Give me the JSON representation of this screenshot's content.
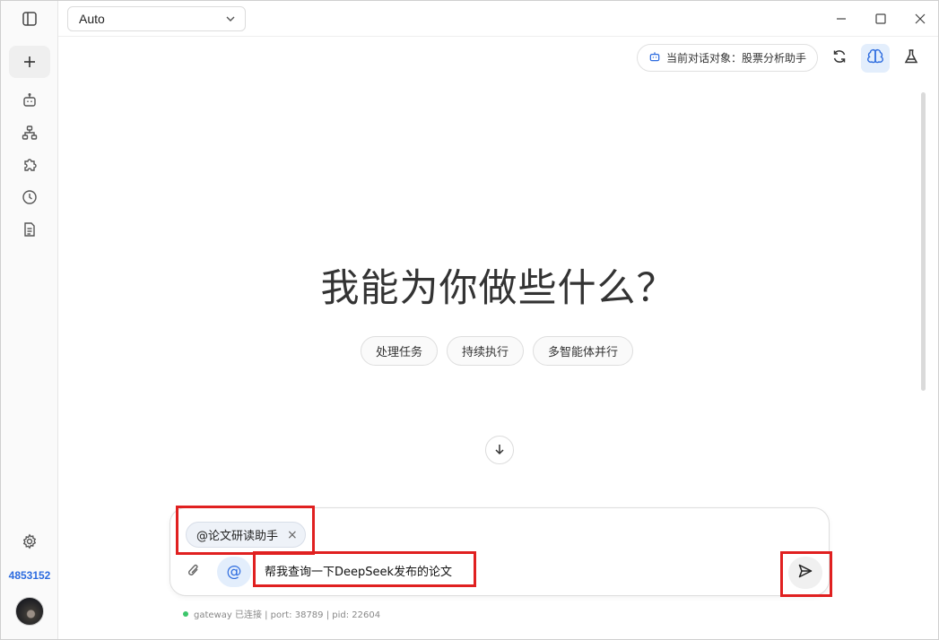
{
  "topbar": {
    "model_value": "Auto"
  },
  "header": {
    "agent_label": "当前对话对象：股票分析助手"
  },
  "hero": {
    "title": "我能为你做些什么？",
    "chips": [
      "处理任务",
      "持续执行",
      "多智能体并行"
    ]
  },
  "composer": {
    "mention_label": "@论文研读助手",
    "mention_remove": "×",
    "at_label": "@",
    "prompt_text": "帮我查询一下DeepSeek发布的论文"
  },
  "status": {
    "text": "gateway 已连接 | port: 38789 | pid: 22604"
  },
  "rail": {
    "user_id": "4853152"
  },
  "colors": {
    "accent": "#2d6cdf",
    "highlight": "#e02020",
    "connected": "#3cc66b"
  }
}
